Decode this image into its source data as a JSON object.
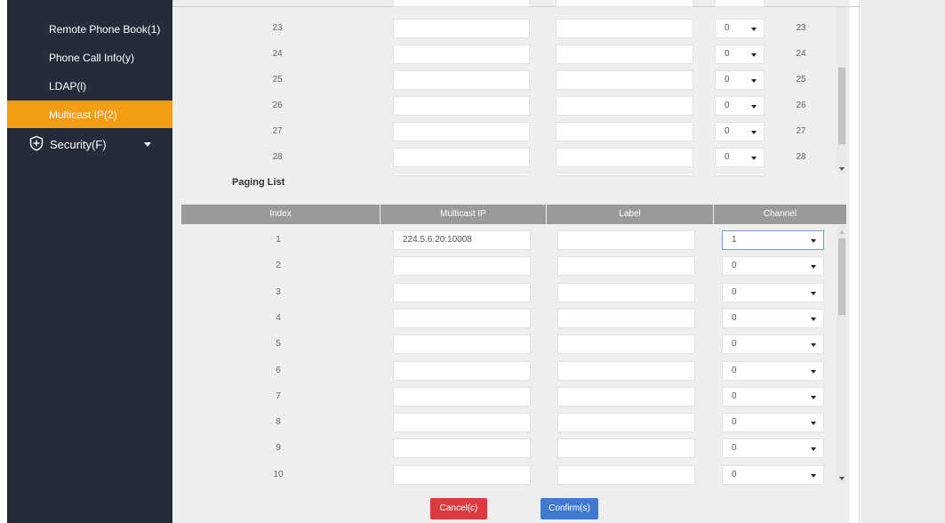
{
  "sidebar": {
    "items": [
      {
        "label": "Remote Phone Book(1)",
        "active": false
      },
      {
        "label": "Phone Call Info(y)",
        "active": false
      },
      {
        "label": "LDAP(l)",
        "active": false
      },
      {
        "label": "Multicast IP(2)",
        "active": true
      }
    ],
    "section": {
      "label": "Security(F)",
      "icon": "shield-plus-icon"
    }
  },
  "upper_table": {
    "rows": [
      {
        "index": "23",
        "multicast_ip": "",
        "label": "",
        "channel": "0",
        "tail": "23"
      },
      {
        "index": "24",
        "multicast_ip": "",
        "label": "",
        "channel": "0",
        "tail": "24"
      },
      {
        "index": "25",
        "multicast_ip": "",
        "label": "",
        "channel": "0",
        "tail": "25"
      },
      {
        "index": "26",
        "multicast_ip": "",
        "label": "",
        "channel": "0",
        "tail": "26"
      },
      {
        "index": "27",
        "multicast_ip": "",
        "label": "",
        "channel": "0",
        "tail": "27"
      },
      {
        "index": "28",
        "multicast_ip": "",
        "label": "",
        "channel": "0",
        "tail": "28"
      }
    ]
  },
  "paging_list": {
    "title": "Paging List",
    "headers": [
      "Index",
      "Multicast IP",
      "Label",
      "Channel"
    ],
    "rows": [
      {
        "index": "1",
        "multicast_ip": "224.5.6.20:10008",
        "label": "",
        "channel": "1"
      },
      {
        "index": "2",
        "multicast_ip": "",
        "label": "",
        "channel": "0"
      },
      {
        "index": "3",
        "multicast_ip": "",
        "label": "",
        "channel": "0"
      },
      {
        "index": "4",
        "multicast_ip": "",
        "label": "",
        "channel": "0"
      },
      {
        "index": "5",
        "multicast_ip": "",
        "label": "",
        "channel": "0"
      },
      {
        "index": "6",
        "multicast_ip": "",
        "label": "",
        "channel": "0"
      },
      {
        "index": "7",
        "multicast_ip": "",
        "label": "",
        "channel": "0"
      },
      {
        "index": "8",
        "multicast_ip": "",
        "label": "",
        "channel": "0"
      },
      {
        "index": "9",
        "multicast_ip": "",
        "label": "",
        "channel": "0"
      },
      {
        "index": "10",
        "multicast_ip": "",
        "label": "",
        "channel": "0"
      }
    ]
  },
  "buttons": {
    "cancel": "Cancel(c)",
    "confirm": "Confirm(s)"
  },
  "colors": {
    "sidebar_bg": "#252b38",
    "active_item": "#f39c12",
    "cancel": "#dd3a3f",
    "confirm": "#3f7ad0",
    "table_header": "#9a9a9a"
  }
}
